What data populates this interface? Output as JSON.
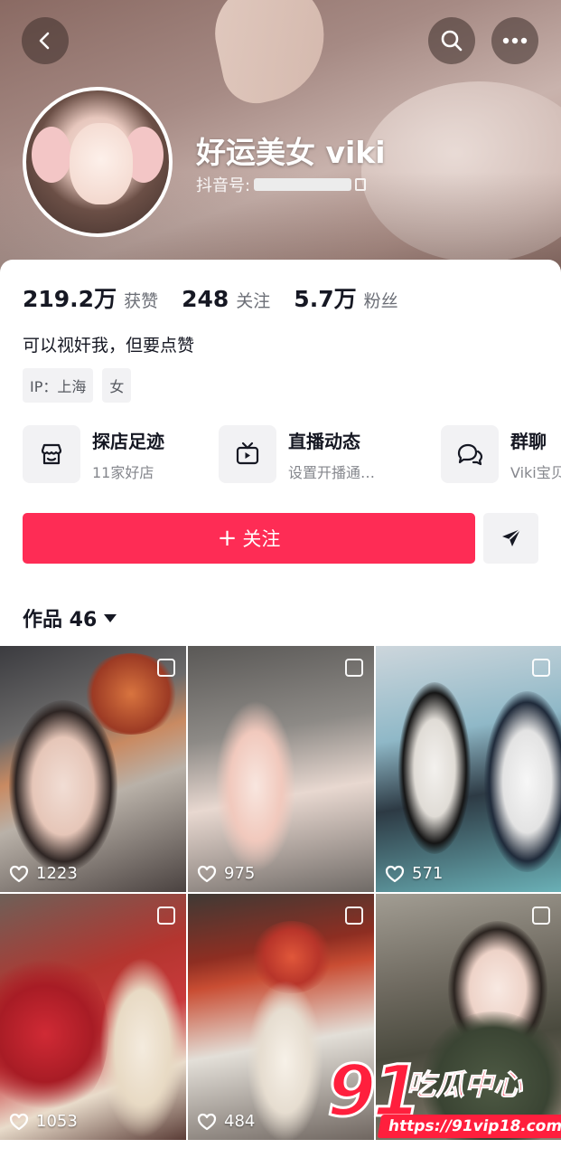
{
  "header": {
    "nickname": "好运美女 viki",
    "douyin_id_label": "抖音号:",
    "icons": {
      "back": "chevron-left-icon",
      "search": "search-icon",
      "more": "more-horizontal-icon"
    }
  },
  "stats": [
    {
      "value": "219.2万",
      "label": "获赞"
    },
    {
      "value": "248",
      "label": "关注"
    },
    {
      "value": "5.7万",
      "label": "粉丝"
    }
  ],
  "bio": "可以视奸我，但要点赞",
  "tags": [
    "IP：上海",
    "女"
  ],
  "features": [
    {
      "title": "探店足迹",
      "subtitle": "11家好店",
      "icon": "store-icon"
    },
    {
      "title": "直播动态",
      "subtitle": "设置开播通…",
      "icon": "tv-icon"
    },
    {
      "title": "群聊",
      "subtitle": "Viki宝贝",
      "icon": "chat-icon"
    }
  ],
  "actions": {
    "follow_label": "关注",
    "follow_prefix": "+",
    "share_icon": "send-icon"
  },
  "works": {
    "label": "作品 46"
  },
  "videos": [
    {
      "likes": "1223"
    },
    {
      "likes": "975"
    },
    {
      "likes": "571"
    },
    {
      "likes": "1053"
    },
    {
      "likes": "484"
    },
    {
      "likes": ""
    }
  ],
  "watermark": {
    "number": "91",
    "name": "吃瓜中心",
    "url": "https://91vip18.com"
  },
  "colors": {
    "accent": "#fe2c55",
    "watermark": "#ff1f3d"
  }
}
